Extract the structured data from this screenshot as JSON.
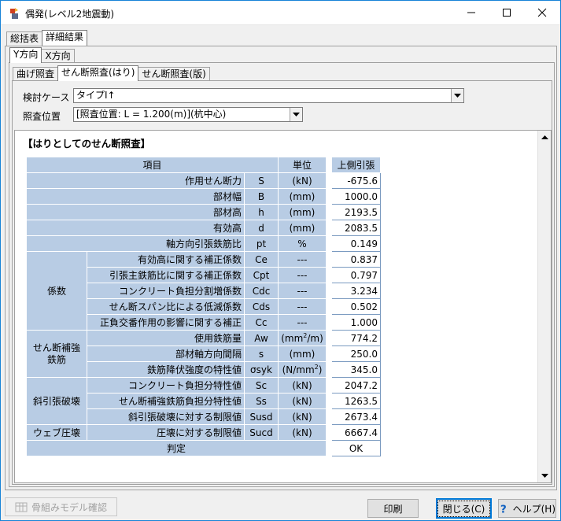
{
  "window": {
    "title": "偶発(レベル2地震動)",
    "accent": "#1883d7"
  },
  "tabs_main": [
    {
      "label": "総括表",
      "active": false
    },
    {
      "label": "詳細結果",
      "active": true
    }
  ],
  "tabs_direction": [
    {
      "label": "Y方向",
      "active": true
    },
    {
      "label": "X方向",
      "active": false
    }
  ],
  "tabs_check": [
    {
      "label": "曲げ照査",
      "active": false
    },
    {
      "label": "せん断照査(はり)",
      "active": true
    },
    {
      "label": "せん断照査(版)",
      "active": false
    }
  ],
  "form": {
    "case_label": "検討ケース",
    "case_value": "タイプⅠ↑",
    "position_label": "照査位置",
    "position_value": "[照査位置: L = 1.200(m)](杭中心)"
  },
  "report": {
    "title": "【はりとしてのせん断照査】",
    "header": {
      "item": "項目",
      "unit": "単位",
      "value": "上側引張"
    },
    "rows": {
      "shear_force": {
        "name": "作用せん断力",
        "symbol": "S",
        "unit": "(kN)",
        "value": "-675.6"
      },
      "width": {
        "name": "部材幅",
        "symbol": "B",
        "unit": "(mm)",
        "value": "1000.0"
      },
      "height": {
        "name": "部材高",
        "symbol": "h",
        "unit": "(mm)",
        "value": "2193.5"
      },
      "eff_height": {
        "name": "有効高",
        "symbol": "d",
        "unit": "(mm)",
        "value": "2083.5"
      },
      "rebar_ratio": {
        "name": "軸方向引張鉄筋比",
        "symbol": "pt",
        "unit": "%",
        "value": "0.149"
      },
      "coef_group": "係数",
      "ce": {
        "name": "有効高に関する補正係数",
        "symbol": "Ce",
        "unit": "---",
        "value": "0.837"
      },
      "cpt": {
        "name": "引張主鉄筋比に関する補正係数",
        "symbol": "Cpt",
        "unit": "---",
        "value": "0.797"
      },
      "cdc": {
        "name": "コンクリート負担分割増係数",
        "symbol": "Cdc",
        "unit": "---",
        "value": "3.234"
      },
      "cds": {
        "name": "せん断スパン比による低減係数",
        "symbol": "Cds",
        "unit": "---",
        "value": "0.502"
      },
      "cc": {
        "name": "正負交番作用の影響に関する補正",
        "symbol": "Cc",
        "unit": "---",
        "value": "1.000"
      },
      "rebar_group": "せん断補強\n鉄筋",
      "aw": {
        "name": "使用鉄筋量",
        "symbol": "Aw",
        "unit_pre": "(mm",
        "unit_sup": "2",
        "unit_post": "/m)",
        "value": "774.2"
      },
      "spacing": {
        "name": "部材軸方向間隔",
        "symbol": "s",
        "unit": "(mm)",
        "value": "250.0"
      },
      "yield": {
        "name": "鉄筋降伏強度の特性値",
        "symbol": "σsyk",
        "unit_pre": "(N/mm",
        "unit_sup": "2",
        "unit_post": ")",
        "value": "345.0"
      },
      "diag_group": "斜引張破壊",
      "sc": {
        "name": "コンクリート負担分特性値",
        "symbol": "Sc",
        "unit": "(kN)",
        "value": "2047.2"
      },
      "ss": {
        "name": "せん断補強鉄筋負担分特性値",
        "symbol": "Ss",
        "unit": "(kN)",
        "value": "1263.5"
      },
      "susd": {
        "name": "斜引張破壊に対する制限値",
        "symbol": "Susd",
        "unit": "(kN)",
        "value": "2673.4"
      },
      "web_group": "ウェブ圧壊",
      "sucd": {
        "name": "圧壊に対する制限値",
        "symbol": "Sucd",
        "unit": "(kN)",
        "value": "6667.4"
      },
      "judge": {
        "name": "判定",
        "value": "OK"
      }
    },
    "header_color": "#b8cce4"
  },
  "buttons": {
    "frame_model": "骨組みモデル確認",
    "print": "印刷",
    "close": "閉じる(C)",
    "help": "ヘルプ(H)"
  }
}
